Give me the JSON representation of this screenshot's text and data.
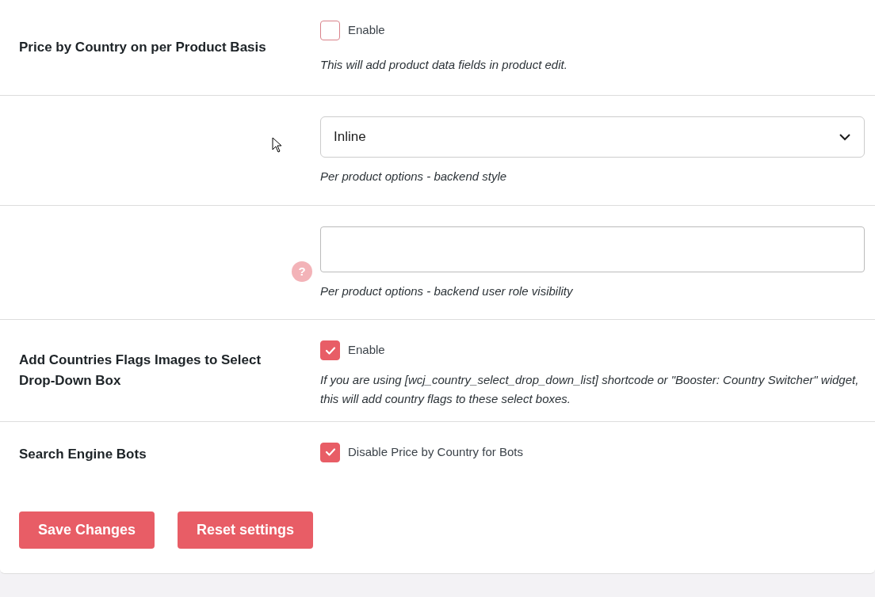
{
  "settings": [
    {
      "kind": "checkbox",
      "label": "Price by Country on per Product Basis",
      "checked": false,
      "option": "Enable",
      "description": "This will add product data fields in product edit."
    },
    {
      "kind": "select",
      "value": "Inline",
      "description": "Per product options - backend style"
    },
    {
      "kind": "text",
      "help": "?",
      "description": "Per product options - backend user role visibility"
    },
    {
      "kind": "checkbox",
      "label": "Add Countries Flags Images to Select Drop-Down Box",
      "checked": true,
      "option": "Enable",
      "description": "If you are using [wcj_country_select_drop_down_list] shortcode or \"Booster: Country Switcher\" widget, this will add country flags to these select boxes."
    },
    {
      "kind": "checkbox",
      "label": "Search Engine Bots",
      "checked": true,
      "option": "Disable Price by Country for Bots"
    }
  ],
  "buttons": [
    "Save Changes",
    "Reset settings"
  ]
}
